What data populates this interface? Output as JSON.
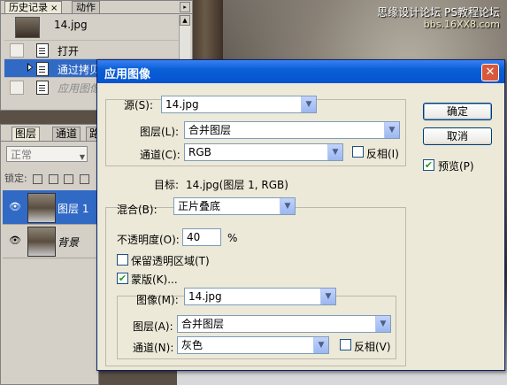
{
  "watermark": {
    "line1": "思缘设计论坛",
    "line2": "PS教程论坛",
    "url": "bbs.16XX8.com"
  },
  "history_panel": {
    "tabs": [
      {
        "label": "历史记录",
        "close": "×"
      },
      {
        "label": "动作"
      }
    ],
    "snapshot_label": "14.jpg",
    "items": [
      {
        "label": "打开"
      },
      {
        "label": "通过拷贝"
      },
      {
        "label": "应用图像"
      }
    ]
  },
  "layers_panel": {
    "tabs": [
      {
        "label": "图层"
      },
      {
        "label": "通道"
      },
      {
        "label": "路"
      }
    ],
    "blend_mode": "正常",
    "lock_label": "锁定:",
    "layers": [
      {
        "name": "图层 1",
        "visible_glyph": "👁"
      },
      {
        "name": "背景",
        "visible_glyph": "👁"
      }
    ]
  },
  "dialog": {
    "title": "应用图像",
    "close_glyph": "✕",
    "source": {
      "label": "源(S):",
      "label_key": "S",
      "value": "14.jpg",
      "layer_label": "图层(L):",
      "layer_key": "L",
      "layer_value": "合并图层",
      "channel_label": "通道(C):",
      "channel_key": "C",
      "channel_value": "RGB",
      "invert_label": "反相(I)",
      "invert_key": "I",
      "invert_checked": false
    },
    "target": {
      "label": "目标:",
      "value": "14.jpg(图层 1, RGB)"
    },
    "blending": {
      "label": "混合(B):",
      "label_key": "B",
      "value": "正片叠底",
      "opacity_label": "不透明度(O):",
      "opacity_key": "O",
      "opacity_value": "40",
      "opacity_unit": "%",
      "preserve_label": "保留透明区域(T)",
      "preserve_key": "T",
      "preserve_checked": false,
      "mask_label": "蒙版(K)...",
      "mask_key": "K",
      "mask_checked": true
    },
    "mask": {
      "image_label": "图像(M):",
      "image_key": "M",
      "image_value": "14.jpg",
      "layer_label": "图层(A):",
      "layer_key": "A",
      "layer_value": "合并图层",
      "channel_label": "通道(N):",
      "channel_key": "N",
      "channel_value": "灰色",
      "invert_label": "反相(V)",
      "invert_key": "V",
      "invert_checked": false
    },
    "buttons": {
      "ok": "确定",
      "cancel": "取消"
    },
    "preview_label": "预览(P)",
    "preview_key": "P",
    "preview_checked": true
  }
}
